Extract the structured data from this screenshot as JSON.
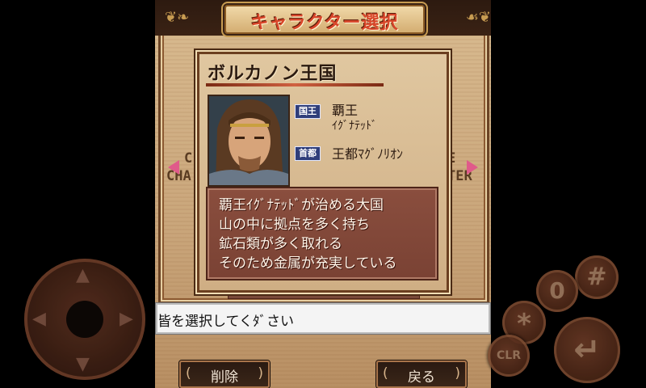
{
  "screen": {
    "title": "キャラクター選択",
    "kingdom": "ボルカノン王国",
    "info": [
      {
        "tag": "国王",
        "value": "覇王",
        "value2": "ｲｸﾞﾅﾃｯﾄﾞ"
      },
      {
        "tag": "首都",
        "value": "王都ﾏｸﾞﾉﾘｵﾝ"
      }
    ],
    "description": [
      "覇王ｲｸﾞﾅﾃｯﾄﾞが治める大国",
      "山の中に拠点を多く持ち",
      "鉱石類が多く取れる",
      "そのため金属が充実している"
    ],
    "side_left": {
      "line1": "C",
      "line2": "CHA"
    },
    "side_right": {
      "line1": "E",
      "line2": "TER"
    },
    "message": "皆を選択してくﾀﾞさい"
  },
  "soft_buttons": {
    "left": "削除",
    "right": "戻る"
  },
  "pad": {
    "labels": {
      "zero": "0",
      "hash": "#",
      "star": "*",
      "clr": "CLR"
    }
  },
  "colors": {
    "title_text": "#d8462a",
    "desc_bg": "#8a4e3e",
    "frame": "#6b3f20",
    "tag_bg": "#2f3e7a",
    "arrow": "#e05a8a"
  }
}
